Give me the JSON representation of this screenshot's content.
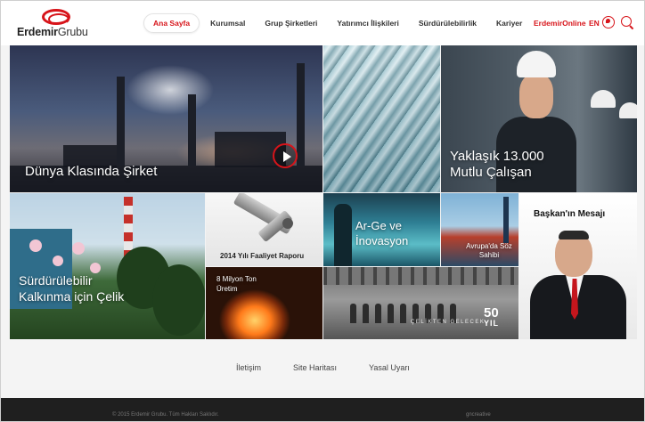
{
  "header": {
    "logo_bold": "Erdemir",
    "logo_light": "Grubu",
    "nav": [
      {
        "label": "Ana Sayfa",
        "active": true
      },
      {
        "label": "Kurumsal"
      },
      {
        "label": "Grup Şirketleri"
      },
      {
        "label": "Yatırımcı İlişkileri"
      },
      {
        "label": "Sürdürülebilirlik"
      },
      {
        "label": "Kariyer"
      }
    ],
    "online": "ErdemirOnline",
    "lang": "EN"
  },
  "tiles": {
    "dunya": "Dünya Klasında Şirket",
    "calisan_1": "Yaklaşık 13.000",
    "calisan_2": "Mutlu Çalışan",
    "surd_1": "Sürdürülebilir",
    "surd_2": "Kalkınma için Çelik",
    "rapor": "2014 Yılı Faaliyet Raporu",
    "milyon": "8 Milyon Ton Üretim",
    "arge": "Ar-Ge ve İnovasyon",
    "tag50": "ÇELİKTEN GELECEK",
    "num50": "50",
    "yil": "YIL",
    "avrupa": "Avrupa'da Söz Sahibi",
    "baskan": "Başkan'ın Mesajı"
  },
  "footer": {
    "links": [
      "İletişim",
      "Site Haritası",
      "Yasal Uyarı"
    ],
    "copyright": "© 2015 Erdemir Grubu. Tüm Hakları Saklıdır.",
    "credit": "gncreative"
  },
  "colors": {
    "accent": "#d7141a",
    "footer_bg": "#1f1f1f",
    "page_bg": "#f4f4f4"
  }
}
